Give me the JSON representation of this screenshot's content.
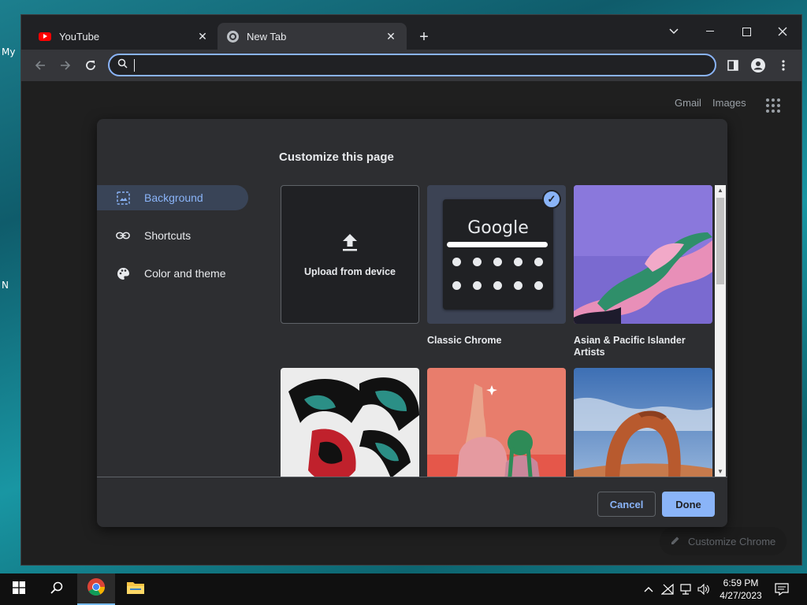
{
  "desktop": {
    "fragments": [
      "My",
      "N"
    ]
  },
  "tabs": [
    {
      "title": "YouTube",
      "icon": "youtube-icon"
    },
    {
      "title": "New Tab",
      "icon": "chrome-icon"
    }
  ],
  "toolbar": {
    "omnibox_value": ""
  },
  "ntp": {
    "gmail": "Gmail",
    "images": "Images",
    "customize_chrome": "Customize Chrome"
  },
  "dialog": {
    "title": "Customize this page",
    "menu": [
      {
        "label": "Background",
        "icon": "image-icon",
        "selected": true
      },
      {
        "label": "Shortcuts",
        "icon": "link-icon",
        "selected": false
      },
      {
        "label": "Color and theme",
        "icon": "palette-icon",
        "selected": false
      }
    ],
    "tiles": {
      "upload": "Upload from device",
      "classic": "Classic Chrome",
      "classic_logo": "Google",
      "collection_1": "Asian & Pacific Islander Artists"
    },
    "cancel": "Cancel",
    "done": "Done"
  },
  "taskbar": {
    "time": "6:59 PM",
    "date": "4/27/2023"
  },
  "colors": {
    "accent": "#8ab4f8",
    "background": "#202124",
    "dialog": "#2d2e31"
  }
}
